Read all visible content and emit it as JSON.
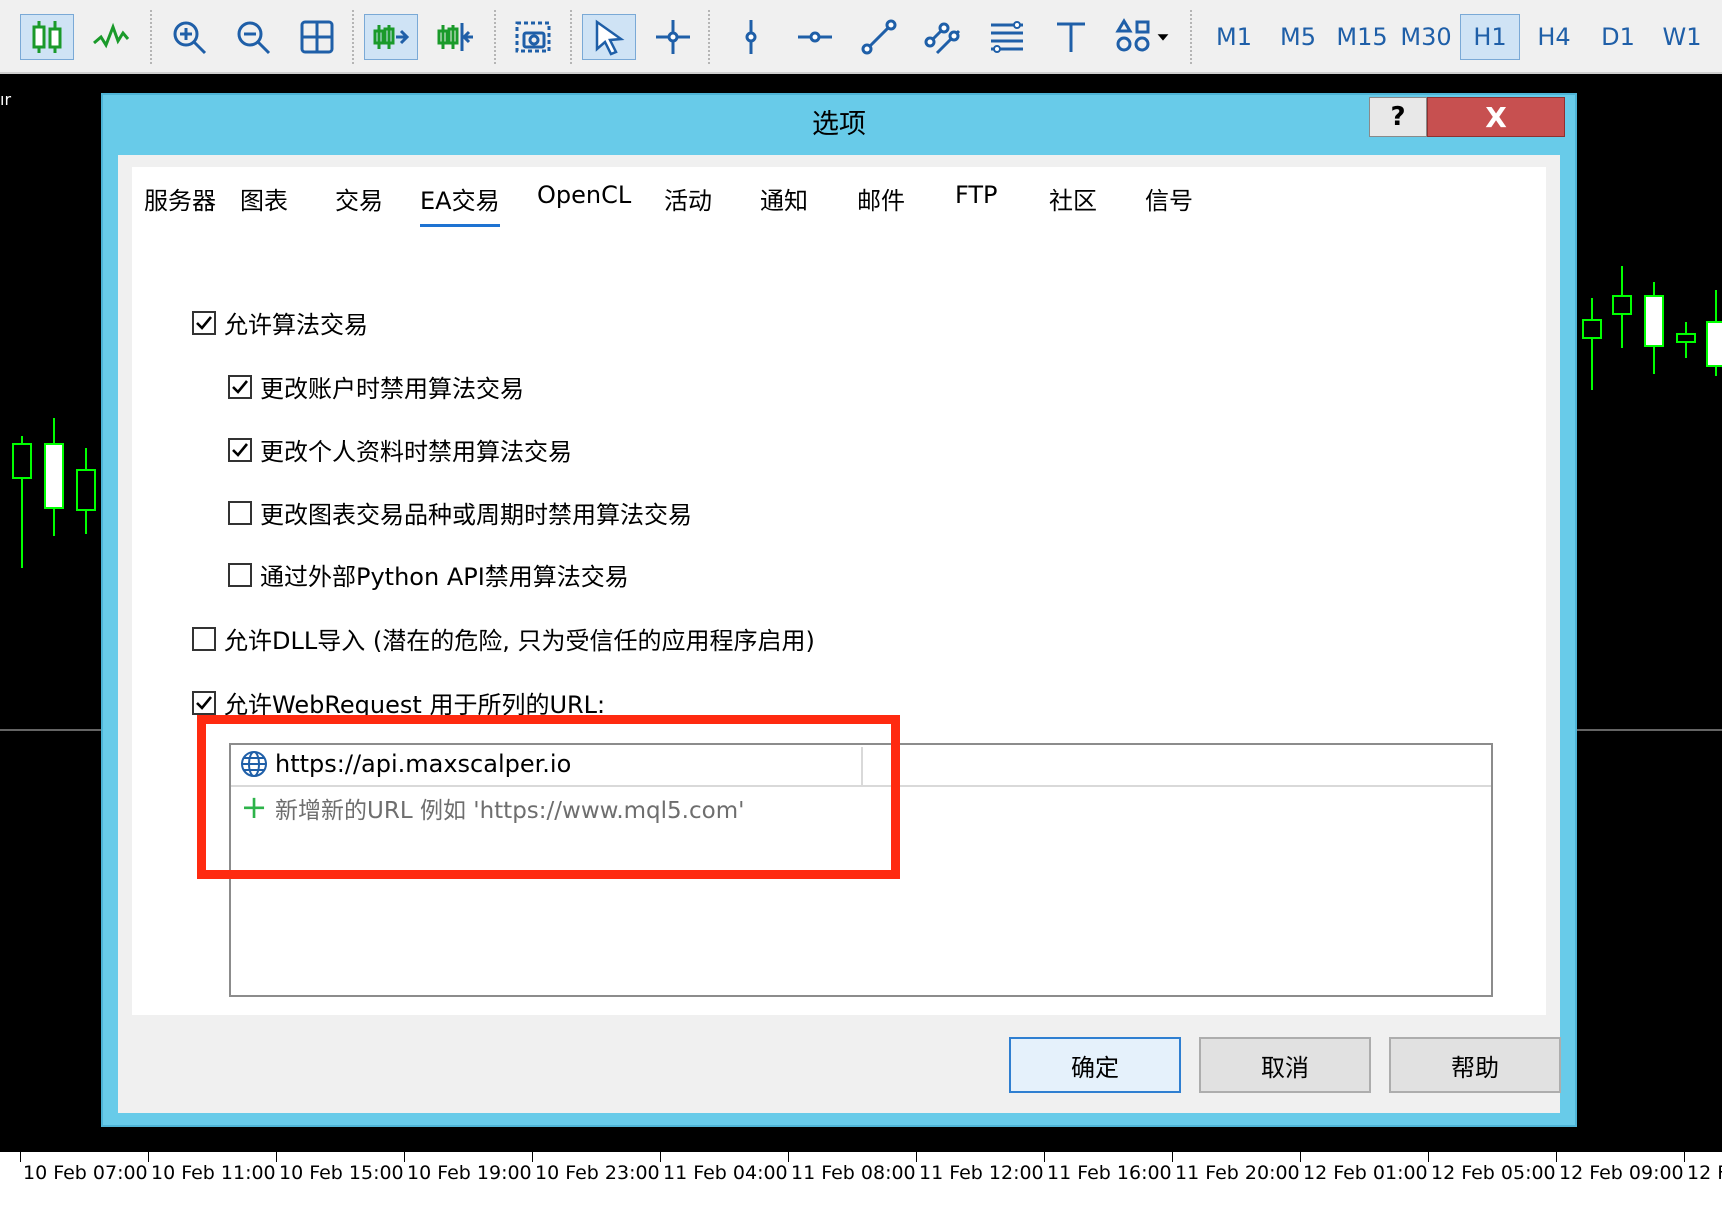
{
  "toolbar": {
    "timeframes": [
      "M1",
      "M5",
      "M15",
      "M30",
      "H1",
      "H4",
      "D1",
      "W1"
    ],
    "active_timeframe": "H1"
  },
  "chart": {
    "corner_text": "ır",
    "time_labels": [
      "10 Feb 07:00",
      "10 Feb 11:00",
      "10 Feb 15:00",
      "10 Feb 19:00",
      "10 Feb 23:00",
      "11 Feb 04:00",
      "11 Feb 08:00",
      "11 Feb 12:00",
      "11 Feb 16:00",
      "11 Feb 20:00",
      "12 Feb 01:00",
      "12 Feb 05:00",
      "12 Feb 09:00",
      "12 F"
    ],
    "candle_color": "#00ff00"
  },
  "dialog": {
    "title": "选项",
    "help_label": "?",
    "close_label": "X",
    "tabs": [
      "服务器",
      "图表",
      "交易",
      "EA交易",
      "OpenCL",
      "活动",
      "通知",
      "邮件",
      "FTP",
      "社区",
      "信号"
    ],
    "active_tab": "EA交易",
    "options": [
      {
        "label": "允许算法交易",
        "checked": true
      },
      {
        "label": "更改账户时禁用算法交易",
        "checked": true
      },
      {
        "label": "更改个人资料时禁用算法交易",
        "checked": true
      },
      {
        "label": "更改图表交易品种或周期时禁用算法交易",
        "checked": false
      },
      {
        "label": "通过外部Python API禁用算法交易",
        "checked": false
      },
      {
        "label": "允许DLL导入 (潜在的危险, 只为受信任的应用程序启用)",
        "checked": false
      },
      {
        "label": "允许WebRequest 用于所列的URL:",
        "checked": true
      }
    ],
    "url_list": {
      "entry": "https://api.maxscalper.io",
      "add_hint": "新增新的URL 例如 'https://www.mql5.com'"
    },
    "buttons": {
      "ok": "确定",
      "cancel": "取消",
      "help": "帮助"
    },
    "highlight_color": "#ff2a10"
  }
}
